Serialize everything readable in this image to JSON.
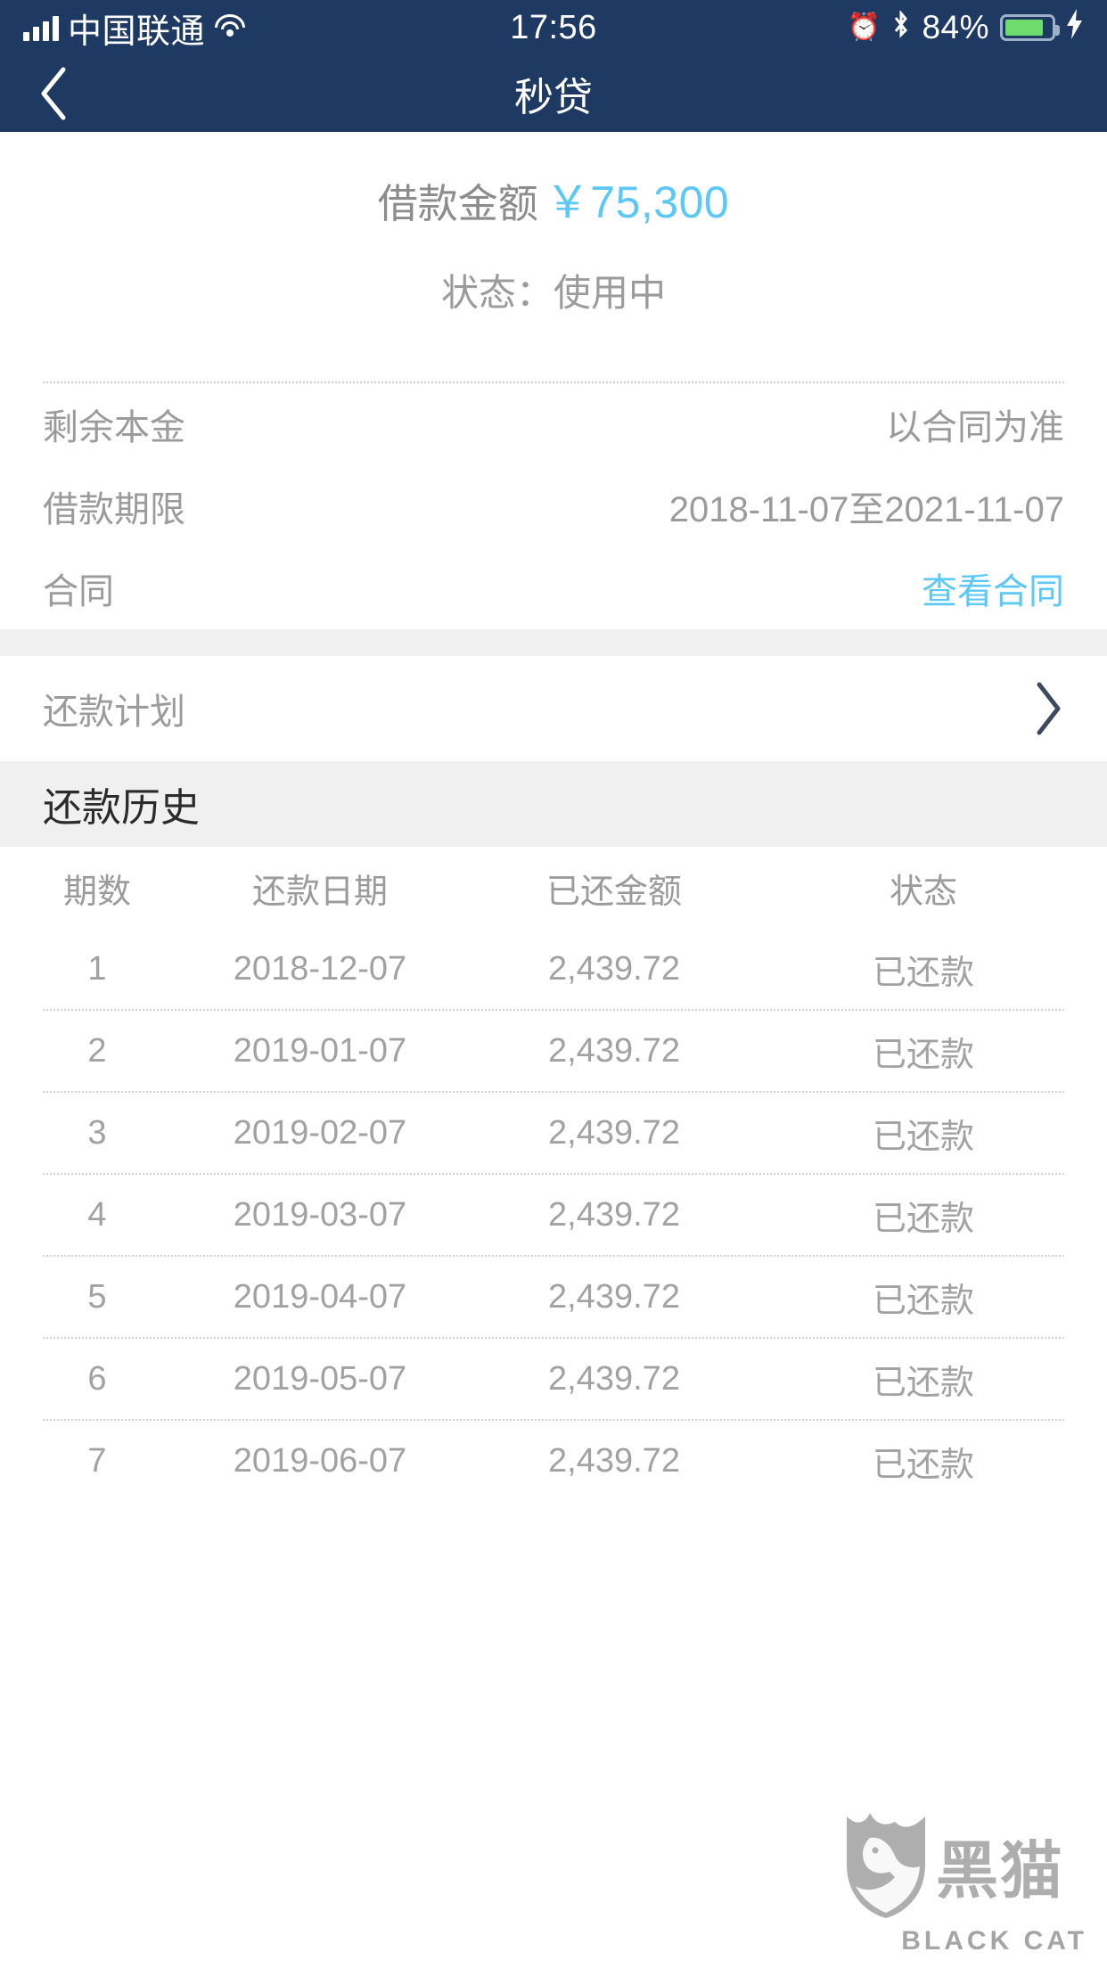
{
  "status_bar": {
    "carrier": "中国联通",
    "time": "17:56",
    "battery_percent": "84%",
    "signal_icon": "signal-bars-icon",
    "wifi_icon": "wifi-icon",
    "alarm_icon": "alarm-clock-icon",
    "bluetooth_icon": "bluetooth-icon",
    "battery_icon": "battery-icon",
    "charging_icon": "lightning-bolt-icon"
  },
  "navbar": {
    "back_icon": "chevron-left-icon",
    "title": "秒贷"
  },
  "summary": {
    "amount_label": "借款金额",
    "amount_value": "￥75,300",
    "status_text": "状态：使用中"
  },
  "info_rows": [
    {
      "label": "剩余本金",
      "value": "以合同为准",
      "is_link": false
    },
    {
      "label": "借款期限",
      "value": "2018-11-07至2021-11-07",
      "is_link": false
    },
    {
      "label": "合同",
      "value": "查看合同",
      "is_link": true
    }
  ],
  "plan_row": {
    "label": "还款计划",
    "chevron_icon": "chevron-right-icon"
  },
  "history": {
    "section_title": "还款历史",
    "columns": [
      "期数",
      "还款日期",
      "已还金额",
      "状态"
    ],
    "rows": [
      {
        "period": "1",
        "date": "2018-12-07",
        "amount": "2,439.72",
        "status": "已还款"
      },
      {
        "period": "2",
        "date": "2019-01-07",
        "amount": "2,439.72",
        "status": "已还款"
      },
      {
        "period": "3",
        "date": "2019-02-07",
        "amount": "2,439.72",
        "status": "已还款"
      },
      {
        "period": "4",
        "date": "2019-03-07",
        "amount": "2,439.72",
        "status": "已还款"
      },
      {
        "period": "5",
        "date": "2019-04-07",
        "amount": "2,439.72",
        "status": "已还款"
      },
      {
        "period": "6",
        "date": "2019-05-07",
        "amount": "2,439.72",
        "status": "已还款"
      },
      {
        "period": "7",
        "date": "2019-06-07",
        "amount": "2,439.72",
        "status": "已还款"
      }
    ]
  },
  "watermark": {
    "logo_icon": "black-cat-shield-icon",
    "brand_cn": "黑猫",
    "brand_en": "BLACK CAT"
  },
  "colors": {
    "navbar_bg": "#1e3a63",
    "accent_blue": "#5bc8f5",
    "muted_text": "#9b9b9b",
    "band_bg": "#f0f0f0",
    "battery_green": "#6ddc6d"
  }
}
